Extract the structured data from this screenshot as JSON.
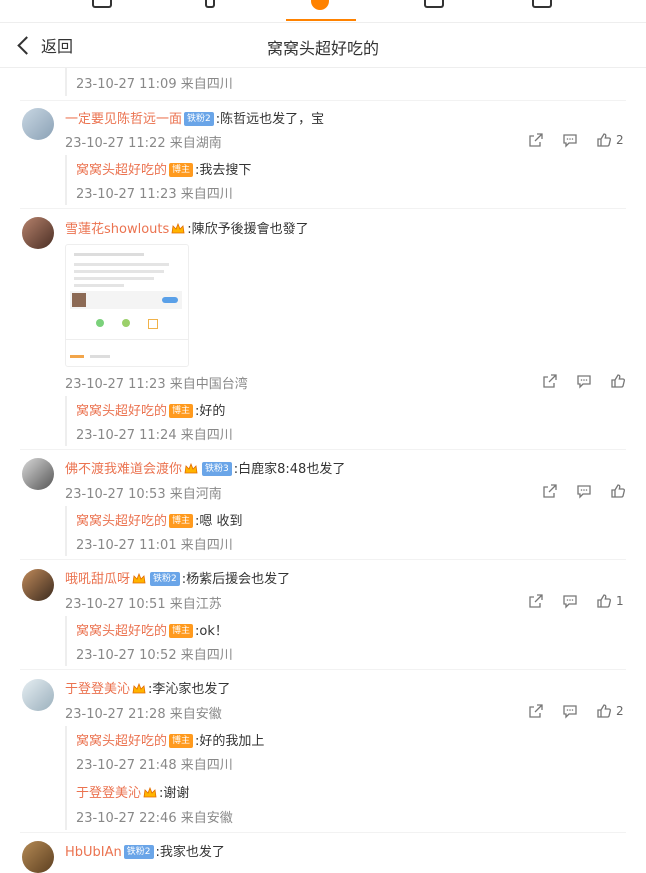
{
  "header": {
    "back_label": "返回",
    "title": "窝窝头超好吃的"
  },
  "colors": {
    "accent": "#ff8200",
    "username": "#eb7350",
    "fan_badge": "#6aa5e8",
    "host_badge": "#ff9a1e"
  },
  "top_reply": {
    "time": "23-10-27 11:09 来自四川"
  },
  "comments": [
    {
      "user": "一定要见陈哲远一面",
      "badge": "铁粉2",
      "text": ":陈哲远也发了，宝",
      "time": "23-10-27 11:22 来自湖南",
      "likes": "2",
      "replies": [
        {
          "user": "窝窝头超好吃的",
          "badge": "博主",
          "text": ":我去搜下",
          "time": "23-10-27 11:23 来自四川"
        }
      ]
    },
    {
      "user": "雪蓮花showlouts",
      "badge": "",
      "text": ":陳欣予後援會也發了",
      "time": "23-10-27 11:23 来自中国台湾",
      "likes": "",
      "replies": [
        {
          "user": "窝窝头超好吃的",
          "badge": "博主",
          "text": ":好的",
          "time": "23-10-27 11:24 来自四川"
        }
      ]
    },
    {
      "user": "佛不渡我难道会渡你",
      "badge": "铁粉3",
      "text": ":白鹿家8:48也发了",
      "time": "23-10-27 10:53 来自河南",
      "likes": "",
      "replies": [
        {
          "user": "窝窝头超好吃的",
          "badge": "博主",
          "text": ":嗯 收到",
          "time": "23-10-27 11:01 来自四川"
        }
      ]
    },
    {
      "user": "哦吼甜瓜呀",
      "badge": "铁粉2",
      "text": ":杨紫后援会也发了",
      "time": "23-10-27 10:51 来自江苏",
      "likes": "1",
      "replies": [
        {
          "user": "窝窝头超好吃的",
          "badge": "博主",
          "text": ":ok！",
          "time": "23-10-27 10:52 来自四川"
        }
      ]
    },
    {
      "user": "于登登美沁",
      "badge": "",
      "text": ":李沁家也发了",
      "time": "23-10-27 21:28 来自安徽",
      "likes": "2",
      "replies": [
        {
          "user": "窝窝头超好吃的",
          "badge": "博主",
          "text": ":好的我加上",
          "time": "23-10-27 21:48 来自四川"
        },
        {
          "user": "于登登美沁",
          "badge": "",
          "text": ":谢谢",
          "time": "23-10-27 22:46 来自安徽"
        }
      ]
    },
    {
      "user": "HbUbIAn",
      "badge": "铁粉2",
      "text": ":我家也发了"
    }
  ],
  "icons": [
    "back-chevron-icon",
    "share-icon",
    "comment-icon",
    "like-icon",
    "crown-icon"
  ]
}
